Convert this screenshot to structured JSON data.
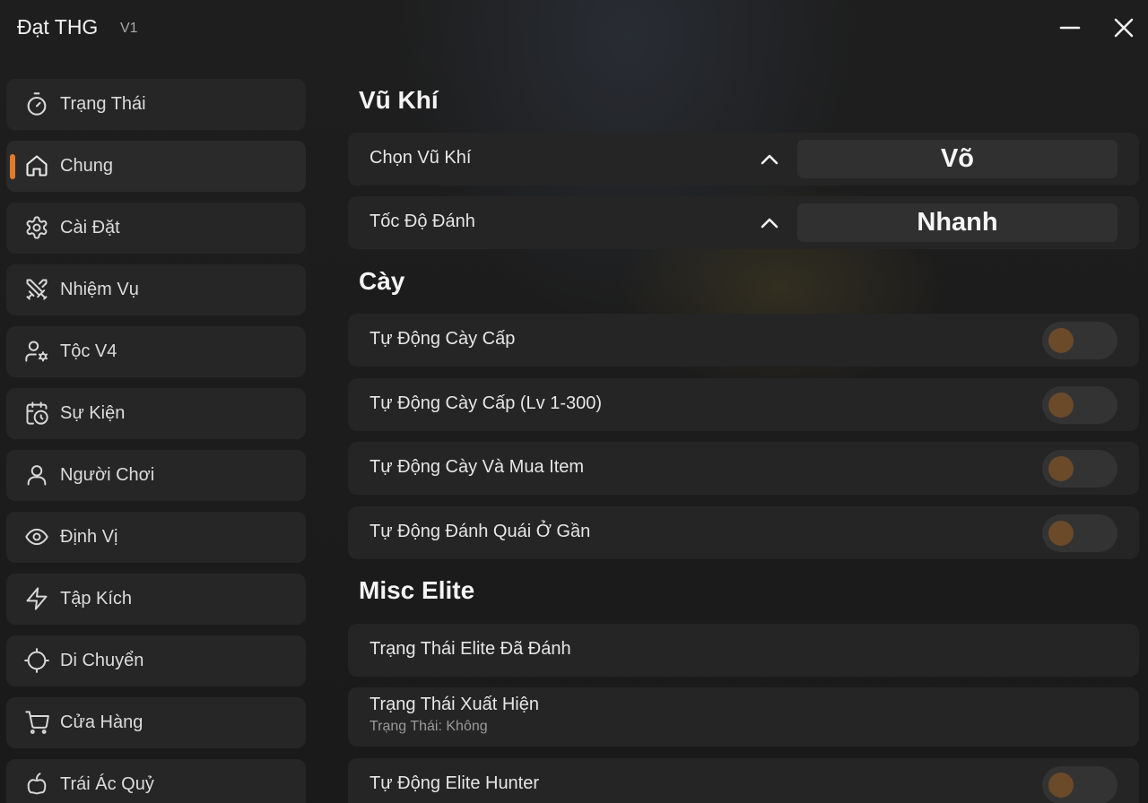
{
  "app": {
    "title": "Đạt THG",
    "version": "V1"
  },
  "accent_color": "#e07b2c",
  "sidebar": {
    "items": [
      {
        "label": "Trạng Thái",
        "icon": "timer-icon"
      },
      {
        "label": "Chung",
        "icon": "home-icon",
        "active": true
      },
      {
        "label": "Cài Đặt",
        "icon": "gear-icon"
      },
      {
        "label": "Nhiệm Vụ",
        "icon": "swords-icon"
      },
      {
        "label": "Tộc V4",
        "icon": "user-cog-icon"
      },
      {
        "label": "Sự Kiện",
        "icon": "calendar-clock-icon"
      },
      {
        "label": "Người Chơi",
        "icon": "user-icon"
      },
      {
        "label": "Định Vị",
        "icon": "eye-icon"
      },
      {
        "label": "Tập Kích",
        "icon": "lightning-icon"
      },
      {
        "label": "Di Chuyển",
        "icon": "crosshair-icon"
      },
      {
        "label": "Cửa Hàng",
        "icon": "cart-icon"
      },
      {
        "label": "Trái Ác Quỷ",
        "icon": "apple-icon"
      }
    ]
  },
  "main": {
    "weapon": {
      "title": "Vũ Khí",
      "select_weapon": {
        "label": "Chọn Vũ Khí",
        "value": "Võ"
      },
      "attack_speed": {
        "label": "Tốc Độ Đánh",
        "value": "Nhanh"
      }
    },
    "farm": {
      "title": "Cày",
      "toggles": [
        {
          "label": "Tự Động Cày Cấp",
          "enabled": false
        },
        {
          "label": "Tự Động Cày Cấp (Lv 1-300)",
          "enabled": false
        },
        {
          "label": "Tự Động Cày Và Mua Item",
          "enabled": false
        },
        {
          "label": "Tự Động Đánh Quái Ở Gần",
          "enabled": false
        }
      ]
    },
    "elite": {
      "title": "Misc Elite",
      "killed_status": "Trạng Thái Elite Đã Đánh",
      "spawn_status": {
        "label": "Trạng Thái Xuất Hiện",
        "sub": "Trạng Thái: Không"
      },
      "hunter": {
        "label": "Tự Động Elite Hunter",
        "enabled": false
      }
    }
  }
}
